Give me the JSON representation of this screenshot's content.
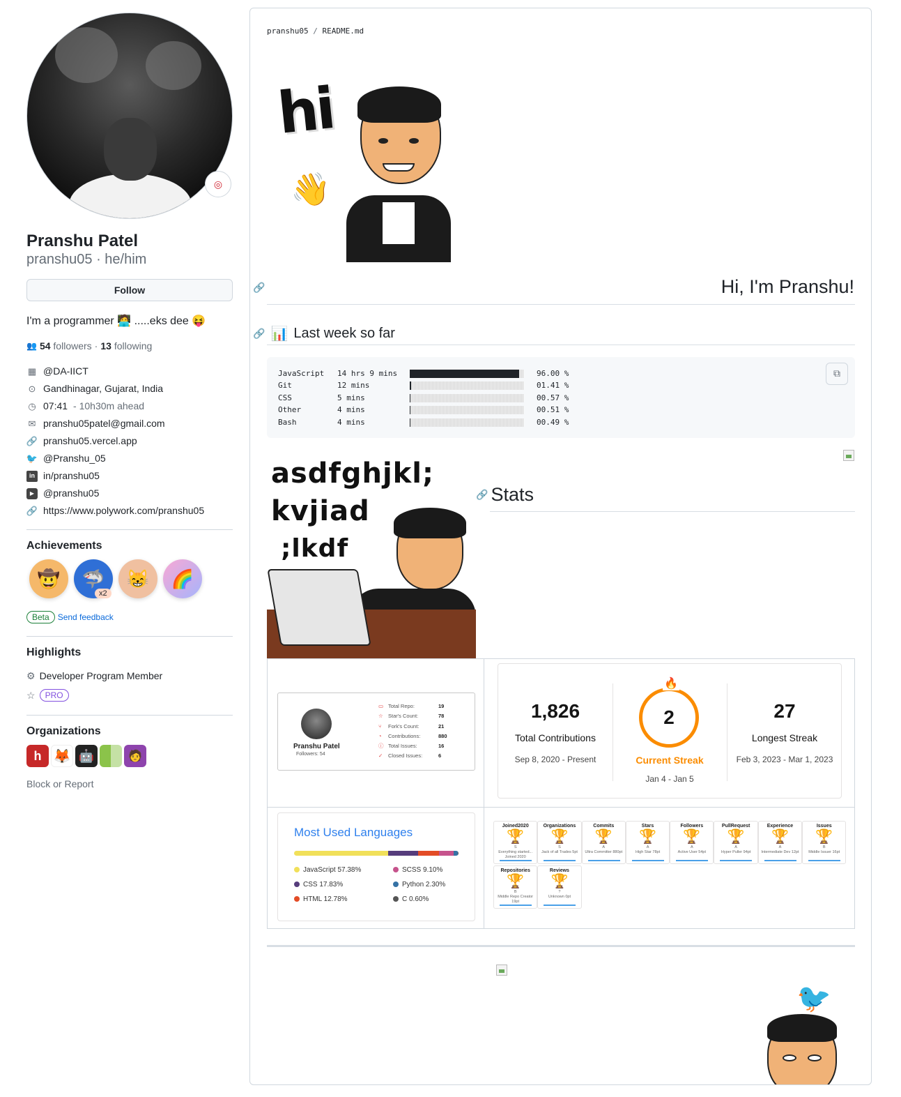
{
  "profile": {
    "name": "Pranshu Patel",
    "handle": "pranshu05 · he/him",
    "follow_label": "Follow",
    "bio": "I'm a programmer 🧑‍💻 .....eks dee 😝",
    "followers_count": "54",
    "followers_label": "followers",
    "separator": " · ",
    "following_count": "13",
    "following_label": "following",
    "details": [
      {
        "icon": "organization-icon",
        "text": "@DA-IICT"
      },
      {
        "icon": "location-icon",
        "text": "Gandhinagar, Gujarat, India"
      },
      {
        "icon": "clock-icon",
        "text": "07:41",
        "extra": "- 10h30m ahead"
      },
      {
        "icon": "mail-icon",
        "text": "pranshu05patel@gmail.com"
      },
      {
        "icon": "link-icon",
        "text": "pranshu05.vercel.app"
      },
      {
        "icon": "twitter-icon",
        "text": "@Pranshu_05"
      },
      {
        "icon": "linkedin-icon",
        "text": "in/pranshu05"
      },
      {
        "icon": "youtube-icon",
        "text": "@pranshu05"
      },
      {
        "icon": "link-icon",
        "text": "https://www.polywork.com/pranshu05"
      }
    ],
    "achievements_title": "Achievements",
    "achievement_multiplier": "x2",
    "beta_label": "Beta",
    "feedback_label": "Send feedback",
    "highlights_title": "Highlights",
    "highlight_member": "Developer Program Member",
    "pro_label": "PRO",
    "organizations_title": "Organizations",
    "block_label": "Block or Report"
  },
  "readme": {
    "path_owner": "pranshu05",
    "path_sep": " / ",
    "path_file": "README.md",
    "greeting": "Hi, I'm Pranshu!",
    "week_title": "Last week so far",
    "week_emoji": "📊",
    "stats_title": "Stats",
    "wakatime": [
      {
        "lang": "JavaScript",
        "time": "14 hrs 9 mins",
        "pct": "96.00 %",
        "frac": 0.96
      },
      {
        "lang": "Git",
        "time": "12 mins",
        "pct": "01.41 %",
        "frac": 0.0141
      },
      {
        "lang": "CSS",
        "time": "5 mins",
        "pct": "00.57 %",
        "frac": 0.0057
      },
      {
        "lang": "Other",
        "time": "4 mins",
        "pct": "00.51 %",
        "frac": 0.0051
      },
      {
        "lang": "Bash",
        "time": "4 mins",
        "pct": "00.49 %",
        "frac": 0.0049
      }
    ]
  },
  "profile_card": {
    "name": "Pranshu Patel",
    "followers": "Followers: 54",
    "stats": [
      {
        "icon": "▭",
        "label": "Total Repo:",
        "value": "19"
      },
      {
        "icon": "☆",
        "label": "Star's Count:",
        "value": "78"
      },
      {
        "icon": "⑂",
        "label": "Fork's Count:",
        "value": "21"
      },
      {
        "icon": "◔",
        "label": "Contributions:",
        "value": "880"
      },
      {
        "icon": "ⓘ",
        "label": "Total Issues:",
        "value": "16"
      },
      {
        "icon": "✓",
        "label": "Closed Issues:",
        "value": "6"
      }
    ]
  },
  "streak": {
    "total": "1,826",
    "total_label": "Total Contributions",
    "total_range": "Sep 8, 2020 - Present",
    "current": "2",
    "current_label": "Current Streak",
    "current_range": "Jan 4 - Jan 5",
    "longest": "27",
    "longest_label": "Longest Streak",
    "longest_range": "Feb 3, 2023 - Mar 1, 2023",
    "accent": "#fb8c00"
  },
  "languages": {
    "title": "Most Used Languages",
    "items": [
      {
        "name": "JavaScript 57.38%",
        "color": "#f1e05a",
        "frac": 0.5738
      },
      {
        "name": "SCSS 9.10%",
        "color": "#c6538c",
        "frac": 0.091
      },
      {
        "name": "CSS 17.83%",
        "color": "#563d7c",
        "frac": 0.1783
      },
      {
        "name": "Python 2.30%",
        "color": "#3572a5",
        "frac": 0.023
      },
      {
        "name": "HTML 12.78%",
        "color": "#e34c26",
        "frac": 0.1278
      },
      {
        "name": "C 0.60%",
        "color": "#555555",
        "frac": 0.006
      }
    ]
  },
  "trophies": [
    {
      "title": "Joined2020",
      "rank": "S",
      "sub": "Everything started... Joined 2020"
    },
    {
      "title": "Organizations",
      "rank": "S",
      "sub": "Jack of all Trades 5pt"
    },
    {
      "title": "Commits",
      "rank": "A",
      "sub": "Ultra Committer 880pt"
    },
    {
      "title": "Stars",
      "rank": "A",
      "sub": "High Star 78pt"
    },
    {
      "title": "Followers",
      "rank": "A",
      "sub": "Active User 54pt"
    },
    {
      "title": "PullRequest",
      "rank": "A",
      "sub": "Hyper Puller 94pt"
    },
    {
      "title": "Experience",
      "rank": "A",
      "sub": "Intermediate Dev 12pt"
    },
    {
      "title": "Issues",
      "rank": "B",
      "sub": "Middle Issuer 16pt"
    },
    {
      "title": "Repositories",
      "rank": "B",
      "sub": "Middle Repo Creator 19pt"
    },
    {
      "title": "Reviews",
      "rank": "?",
      "sub": "Unknown 0pt"
    }
  ],
  "art": {
    "hi_text": "hi",
    "keyboard_text_1": "asdfghjkl;",
    "keyboard_text_2": "kvjiad",
    "keyboard_text_3": ";lkdf"
  }
}
